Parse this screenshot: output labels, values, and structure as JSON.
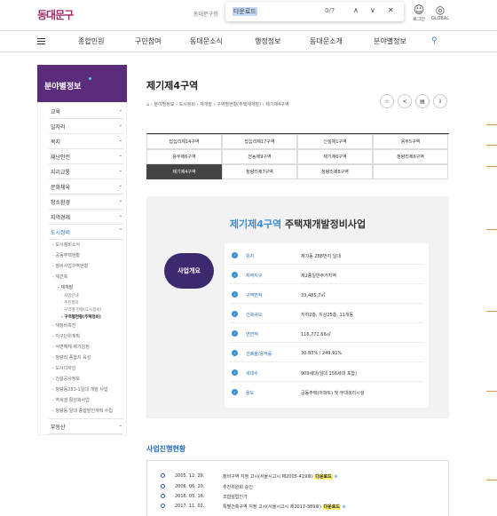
{
  "header": {
    "logo": "동대문구",
    "org": "동대문구청",
    "login": "로그인",
    "global": "GLOBAL"
  },
  "find_bar": {
    "query": "다운로드",
    "count": "0/7"
  },
  "nav": {
    "items": [
      "종합민원",
      "구민참여",
      "동대문소식",
      "행정정보",
      "동대문소개",
      "분야별정보"
    ]
  },
  "sidebar": {
    "title": "분야별정보",
    "items": [
      {
        "label": "교육",
        "arrow": "⌄"
      },
      {
        "label": "일자리",
        "arrow": "⌄"
      },
      {
        "label": "복지",
        "arrow": "⌄"
      },
      {
        "label": "재난안전",
        "arrow": "⌄"
      },
      {
        "label": "지리교통",
        "arrow": "⌄"
      },
      {
        "label": "문화체육",
        "arrow": "⌄"
      },
      {
        "label": "청소환경",
        "arrow": "⌄"
      },
      {
        "label": "지역경제",
        "arrow": "⌄"
      },
      {
        "label": "도시정비",
        "arrow": "^"
      }
    ],
    "sub_top": [
      "도시정비소식",
      "공동주택현황",
      "정비사업구역현황",
      "재건축"
    ],
    "sub_open": "재개발",
    "sub_open_children": [
      "사업안내",
      "추진절차",
      "구역별 현황(도시정비)",
      "구역별현황(주택정비)"
    ],
    "sub_bottom": [
      "재정비촉진",
      "지구단위계획",
      "석면해체·제거감정",
      "청량리 종합지 육성",
      "도시디자인",
      "건설공사정보",
      "청량동283-1일대 개발 사업",
      "역세권 활성화사업",
      "청량동 일대 종합발전계획 수립"
    ],
    "last": "부동산"
  },
  "main": {
    "title": "제기제4구역",
    "breadcrumb": [
      "분야별정보",
      "도시정비",
      "재개발",
      "구역별현황(주택재개발)",
      "제기제4구역"
    ],
    "tabs": [
      "답십리제14구역",
      "답십리제17구역",
      "신설제1구역",
      "용두5구역",
      "용두제6구역",
      "전농제9구역",
      "제기제6구역",
      "청량리제6구역",
      "제기제4구역",
      "청량리제7구역",
      "청량리제8구역"
    ],
    "active_tab": "제기제4구역"
  },
  "overview": {
    "title_highlight": "제기제4구역",
    "title_rest": "주택재개발정비사업",
    "badge": "사업개요",
    "rows": [
      {
        "key": "위치",
        "value": "제기동 288번지 일대"
      },
      {
        "key": "지역지구",
        "value": "제2종일반주거지역"
      },
      {
        "key": "구역면적",
        "value": "33,485.7㎡"
      },
      {
        "key": "건축규모",
        "value": "지하2층, 지상25층, 11개동"
      },
      {
        "key": "연면적",
        "value": "116,772.66㎡"
      },
      {
        "key": "건폐율/용적률",
        "value": "30.83% / 249.91%"
      },
      {
        "key": "세대수",
        "value": "909세대(임대 156세대 포함)"
      },
      {
        "key": "용도",
        "value": "공동주택(아파트) 및 부대복리시설"
      }
    ]
  },
  "history": {
    "title": "사업진행현황",
    "items": [
      {
        "date": "2005. 12. 29.",
        "text": "정비구역 지정 고시(서울시고시 제2005-419호)",
        "link": "다운로드"
      },
      {
        "date": "2006. 06. 20.",
        "text": "추진위원회 승인",
        "link": ""
      },
      {
        "date": "2016. 05. 16.",
        "text": "조합설립인가",
        "link": ""
      },
      {
        "date": "2017. 11. 02.",
        "text": "특별건축구역 지정 고시(서울시고시 제2017-389호)",
        "link": "다운로드"
      }
    ]
  },
  "colors": {
    "brand": "#5b2c7b",
    "accent": "#2a6fc0",
    "highlight": "#fff176"
  }
}
